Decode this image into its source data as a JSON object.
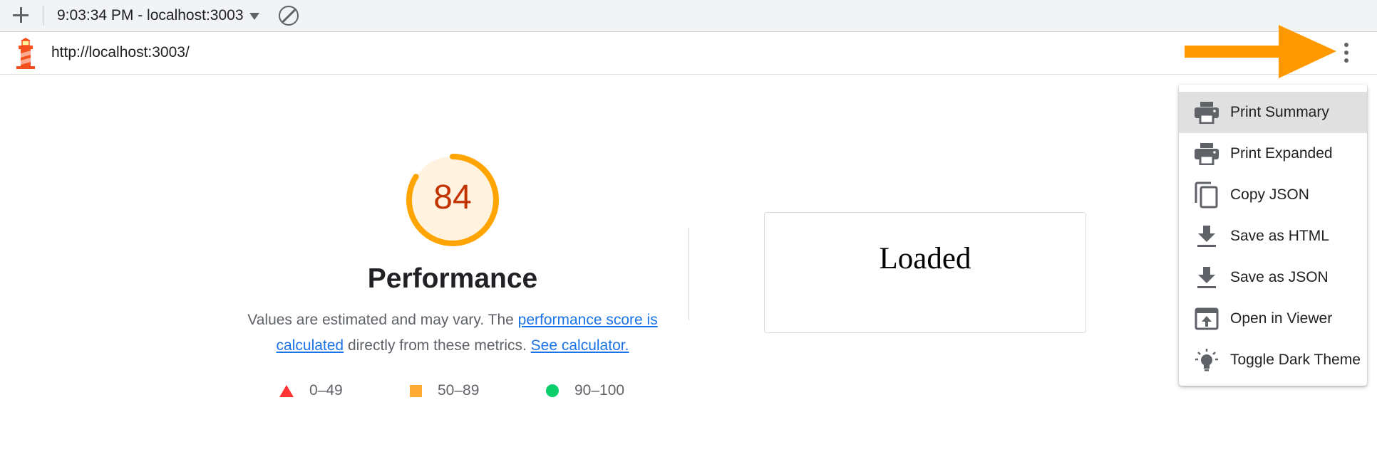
{
  "topbar": {
    "session_label": "9:03:34 PM - localhost:3003"
  },
  "urlbar": {
    "url": "http://localhost:3003/"
  },
  "report": {
    "score": "84",
    "category_title": "Performance",
    "description_prefix": "Values are estimated and may vary. The ",
    "link_score": "performance score is calculated",
    "description_mid": " directly from these metrics. ",
    "link_calculator": "See calculator.",
    "legend": [
      {
        "range": "0–49",
        "color": "#ff3333"
      },
      {
        "range": "50–89",
        "color": "#ffaa33"
      },
      {
        "range": "90–100",
        "color": "#0cce6b"
      }
    ],
    "screenshot_text": "Loaded"
  },
  "menu": {
    "items": [
      {
        "label": "Print Summary",
        "icon": "printer-icon"
      },
      {
        "label": "Print Expanded",
        "icon": "printer-icon"
      },
      {
        "label": "Copy JSON",
        "icon": "copy-icon"
      },
      {
        "label": "Save as HTML",
        "icon": "download-icon"
      },
      {
        "label": "Save as JSON",
        "icon": "download-icon"
      },
      {
        "label": "Open in Viewer",
        "icon": "open-in-new-icon"
      },
      {
        "label": "Toggle Dark Theme",
        "icon": "lightbulb-icon"
      }
    ]
  },
  "colors": {
    "score_average": "#c33300",
    "gauge_arc": "#ffa400",
    "link": "#1a73e8",
    "annotation_arrow": "#ff9900"
  }
}
